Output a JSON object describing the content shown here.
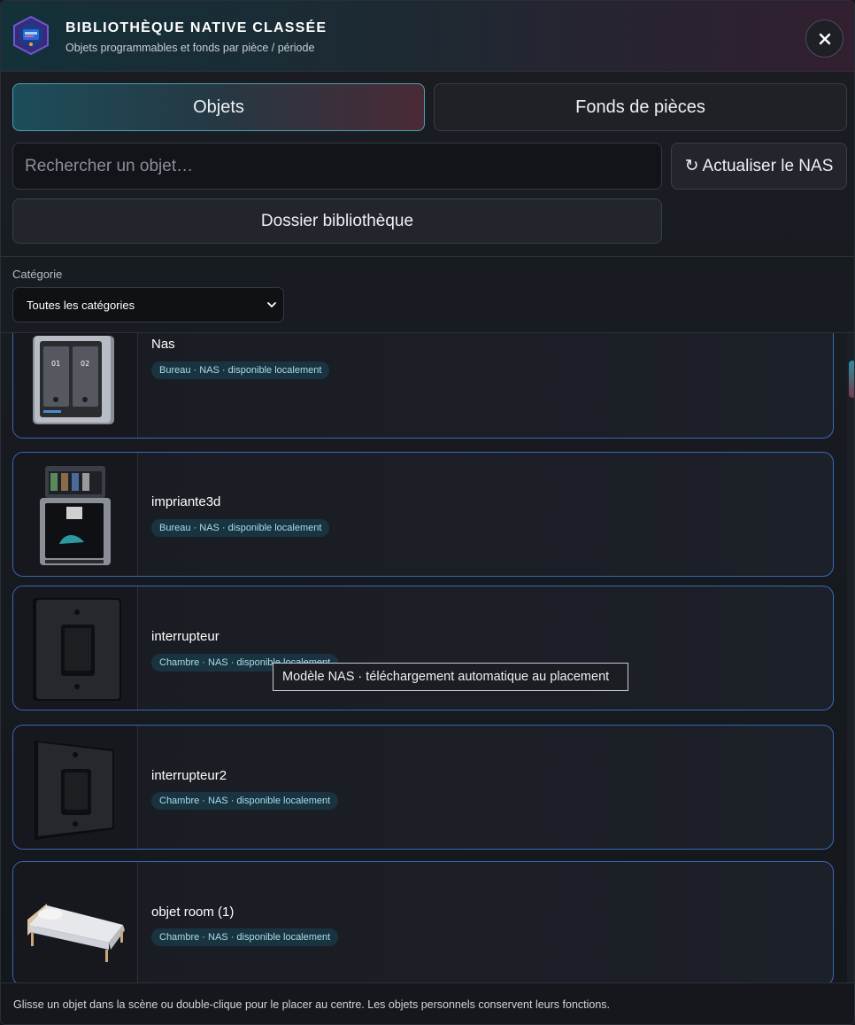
{
  "header": {
    "title": "BIBLIOTHÈQUE NATIVE CLASSÉE",
    "subtitle": "Objets programmables et fonds par pièce / période",
    "close_icon": "close-icon"
  },
  "tabs": [
    {
      "label": "Objets",
      "active": true
    },
    {
      "label": "Fonds de pièces",
      "active": false
    }
  ],
  "search": {
    "placeholder": "Rechercher un objet…",
    "value": ""
  },
  "refresh": {
    "icon": "↻",
    "label": "Actualiser le NAS"
  },
  "folder_button": {
    "label": "Dossier bibliothèque"
  },
  "category": {
    "label": "Catégorie",
    "selected": "Toutes les catégories"
  },
  "items": [
    {
      "name": "Nas",
      "tag": "Bureau · NAS · disponible localement",
      "icon": "nas-icon"
    },
    {
      "name": "impriante3d",
      "tag": "Bureau · NAS · disponible localement",
      "icon": "3d-printer-icon"
    },
    {
      "name": "interrupteur",
      "tag": "Chambre · NAS · disponible localement",
      "icon": "light-switch-icon"
    },
    {
      "name": "interrupteur2",
      "tag": "Chambre · NAS · disponible localement",
      "icon": "light-switch-icon"
    },
    {
      "name": "objet room (1)",
      "tag": "Chambre · NAS · disponible localement",
      "icon": "bed-icon"
    }
  ],
  "tooltip": "Modèle NAS · téléchargement automatique au placement",
  "footer": "Glisse un objet dans la scène ou double-clique pour le placer au centre. Les objets personnels conservent leurs fonctions.",
  "colors": {
    "accent": "#4aa0ae",
    "card_border": "#3a68b8",
    "badge_bg": "#193440",
    "badge_text": "#a9dcec"
  }
}
